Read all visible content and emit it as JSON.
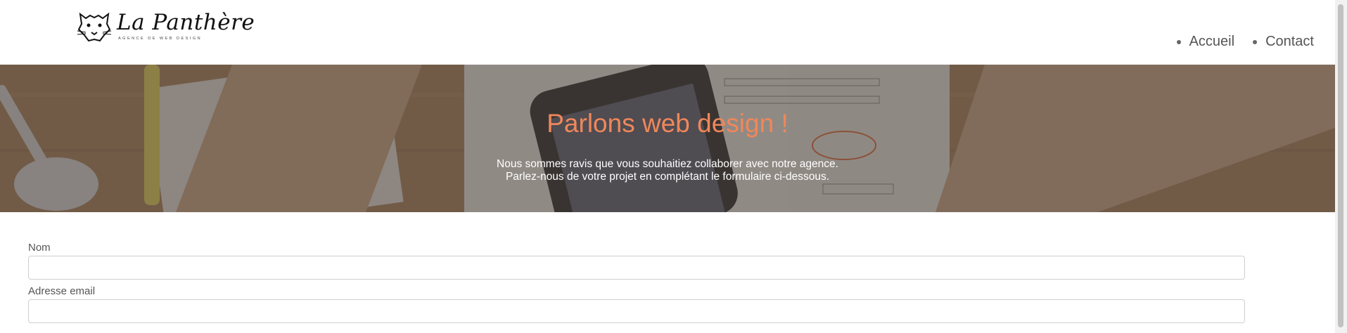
{
  "header": {
    "logo_name": "La Panthère",
    "logo_tagline": "AGENCE DE WEB DESIGN",
    "nav": [
      {
        "label": "Accueil"
      },
      {
        "label": "Contact"
      }
    ]
  },
  "hero": {
    "title": "Parlons web design !",
    "line1": "Nous sommes ravis que vous souhaitiez collaborer avec notre agence.",
    "line2": "Parlez-nous de votre projet en complétant le formulaire ci-dessous."
  },
  "form": {
    "name_label": "Nom",
    "email_label": "Adresse email"
  },
  "colors": {
    "title_accent": "#f0875a",
    "text": "#555555",
    "hero_overlay": "#463c37"
  },
  "icons": {
    "logo": "panther-head-icon",
    "nav_bullet": "bullet-icon"
  }
}
